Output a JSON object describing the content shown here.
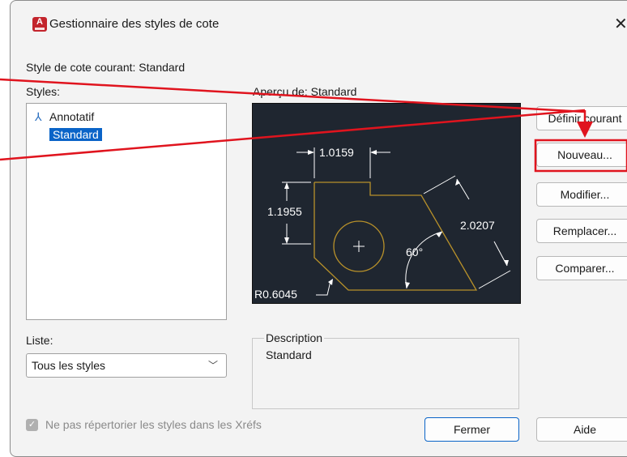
{
  "window": {
    "title": "Gestionnaire des styles de cote",
    "app_icon_letter": "A",
    "close_glyph": "✕"
  },
  "current_style_label": "Style de cote courant: Standard",
  "styles": {
    "label": "Styles:",
    "items": [
      {
        "label": "Annotatif",
        "annotative": true,
        "selected": false
      },
      {
        "label": "Standard",
        "annotative": false,
        "selected": true
      }
    ]
  },
  "preview": {
    "label": "Aperçu de: Standard",
    "dimensions": {
      "horizontal": "1.0159",
      "vertical": "1.1955",
      "aligned": "2.0207",
      "angle": "60°",
      "radius": "R0.6045"
    }
  },
  "list_filter": {
    "label": "Liste:",
    "value": "Tous les styles"
  },
  "description": {
    "label": "Description",
    "text": "Standard"
  },
  "buttons": {
    "set_current": "Définir courant",
    "new": "Nouveau...",
    "modify": "Modifier...",
    "replace": "Remplacer...",
    "compare": "Comparer...",
    "close": "Fermer",
    "help": "Aide"
  },
  "xref_checkbox": {
    "label": "Ne pas répertorier les styles dans les Xréfs",
    "checked": true,
    "enabled": false
  },
  "annotation_color": "#e0141e",
  "colors": {
    "preview_bg": "#1f2630",
    "geometry": "#b8912a",
    "selection": "#0a64c8"
  }
}
